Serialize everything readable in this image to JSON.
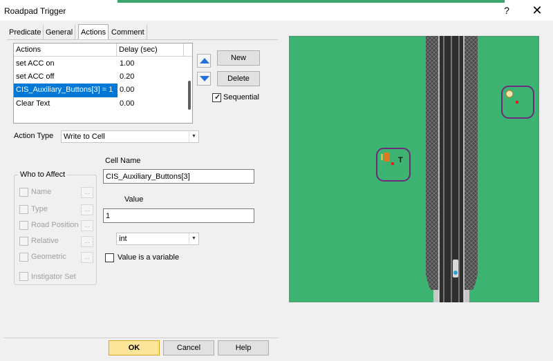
{
  "window": {
    "title": "Roadpad Trigger",
    "help_glyph": "?",
    "close_glyph": "✕"
  },
  "tabs": [
    {
      "label": "Predicate"
    },
    {
      "label": "General"
    },
    {
      "label": "Actions"
    },
    {
      "label": "Comment"
    }
  ],
  "actions_list": {
    "columns": {
      "action": "Actions",
      "delay": "Delay (sec)"
    },
    "rows": [
      {
        "action": "set ACC on",
        "delay": "1.00"
      },
      {
        "action": "set ACC off",
        "delay": "0.20"
      },
      {
        "action": "CIS_Auxiliary_Buttons[3] = 1",
        "delay": "0.00"
      },
      {
        "action": "Clear Text",
        "delay": "0.00"
      }
    ]
  },
  "buttons": {
    "new": "New",
    "delete": "Delete",
    "ok": "OK",
    "cancel": "Cancel",
    "help": "Help"
  },
  "sequential": {
    "label": "Sequential",
    "checked": true
  },
  "action_type": {
    "label": "Action Type",
    "value": "Write to Cell"
  },
  "who_to_affect": {
    "title": "Who to Affect",
    "items": [
      {
        "label": "Name"
      },
      {
        "label": "Type"
      },
      {
        "label": "Road Position"
      },
      {
        "label": "Relative"
      },
      {
        "label": "Geometric"
      },
      {
        "label": "Instigator Set"
      }
    ],
    "dots": "..."
  },
  "cell_name": {
    "label": "Cell Name",
    "value": "CIS_Auxiliary_Buttons[3]"
  },
  "value_field": {
    "label": "Value",
    "value": "1"
  },
  "value_type": {
    "value": "int"
  },
  "value_is_variable": {
    "label": "Value is a variable",
    "checked": false
  },
  "map": {
    "sign_letter": "T",
    "colors": {
      "grass": "#3cb371",
      "road": "#333333",
      "shoulder": "#4a4a4a",
      "marker": "#6b2b7a"
    }
  }
}
